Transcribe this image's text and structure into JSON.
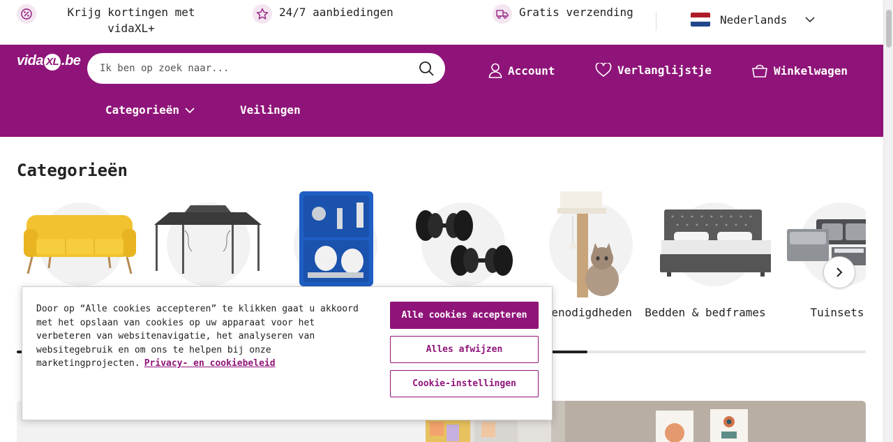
{
  "usp": {
    "items": [
      {
        "icon": "percent-icon",
        "text": "Krijg kortingen met vidaXL+"
      },
      {
        "icon": "star-icon",
        "text": "24/7 aanbiedingen"
      },
      {
        "icon": "truck-icon",
        "text": "Gratis verzending"
      }
    ]
  },
  "language": {
    "label": "Nederlands",
    "flag": "nl-flag-icon"
  },
  "header": {
    "logo_text": "vida",
    "logo_xl": "XL",
    "logo_suffix": ".be",
    "search_placeholder": "Ik ben op zoek naar...",
    "account_label": "Account",
    "wishlist_label": "Verlanglijstje",
    "cart_label": "Winkelwagen",
    "nav": {
      "categories_label": "Categorieën",
      "auctions_label": "Veilingen"
    }
  },
  "categories": {
    "title": "Categorieën",
    "items": [
      {
        "label": "",
        "image": "yellow-sofa"
      },
      {
        "label": "",
        "image": "gazebo"
      },
      {
        "label": "",
        "image": "spray-gun-kit"
      },
      {
        "label": "",
        "image": "dumbbells"
      },
      {
        "label": "rbenodigdheden",
        "image": "cat-tree"
      },
      {
        "label": "Bedden & bedframes",
        "image": "bed"
      },
      {
        "label": "Tuinsets",
        "image": "garden-set"
      }
    ],
    "progress_fraction": 0.672
  },
  "cookie": {
    "text": "Door op “Alle cookies accepteren” te klikken gaat u akkoord met het opslaan van cookies op uw apparaat voor het verbeteren van websitenavigatie, het analyseren van websitegebruik en om ons te helpen bij onze marketingprojecten.",
    "policy_link": "Privacy- en cookiebeleid",
    "accept_label": "Alle cookies accepteren",
    "reject_label": "Alles afwijzen",
    "settings_label": "Cookie-instellingen"
  },
  "colors": {
    "brand": "#8f1479",
    "brand_light": "#f3e6f1"
  }
}
